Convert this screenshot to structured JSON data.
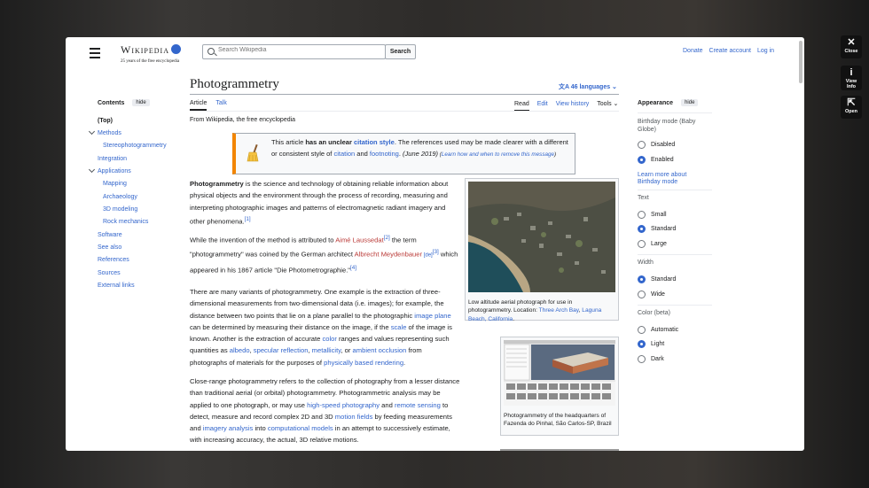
{
  "header": {
    "logo_word": "Wikipedia",
    "logo_tagline": "25 years of the free encyclopedia",
    "search_placeholder": "Search Wikipedia",
    "search_button": "Search",
    "donate": "Donate",
    "create_account": "Create account",
    "login": "Log in"
  },
  "toc": {
    "title": "Contents",
    "hide": "hide",
    "items": [
      "(Top)",
      "Methods",
      "Stereophotogrammetry",
      "Integration",
      "Applications",
      "Mapping",
      "Archaeology",
      "3D modeling",
      "Rock mechanics",
      "Software",
      "See also",
      "References",
      "Sources",
      "External links"
    ]
  },
  "article": {
    "title": "Photogrammetry",
    "languages": "46 languages",
    "tab_article": "Article",
    "tab_talk": "Talk",
    "tab_read": "Read",
    "tab_edit": "Edit",
    "tab_history": "View history",
    "tab_tools": "Tools",
    "from": "From Wikipedia, the free encyclopedia"
  },
  "ambox": {
    "t1": "This article ",
    "t2": "has an unclear ",
    "t3": "citation style",
    "t4": ". The references used may be made clearer with a different or consistent style of ",
    "t5": "citation",
    "t6": " and ",
    "t7": "footnoting",
    "t8": ". ",
    "t9": "(June 2019)",
    "t10": " (",
    "t11": "Learn how and when to remove this message",
    "t12": ")"
  },
  "p1": {
    "bold": "Photogrammetry",
    "text": " is the science and technology of obtaining reliable information about physical objects and the environment through the process of recording, measuring and interpreting photographic images and patterns of electromagnetic radiant imagery and other phenomena.",
    "ref": "[1]"
  },
  "p2": {
    "a": "While the invention of the method is attributed to ",
    "b": "Aimé Laussedat",
    "c": "[2]",
    "d": " the term \"photogrammetry\" was coined by the German architect ",
    "e": "Albrecht Meydenbauer",
    "f": " [de]",
    "g": "[3]",
    "h": " which appeared in his 1867 article \"Die Photometrographie.\"",
    "i": "[4]"
  },
  "p3": {
    "a": "There are many variants of photogrammetry. One example is the extraction of three-dimensional measurements from two-dimensional data (i.e. images); for example, the distance between two points that lie on a plane parallel to the photographic ",
    "b": "image plane",
    "c": " can be determined by measuring their distance on the image, if the ",
    "d": "scale",
    "e": " of the image is known. Another is the extraction of accurate ",
    "f": "color",
    "g": " ranges and values representing such quantities as ",
    "h": "albedo",
    "i": ", ",
    "j": "specular reflection",
    "k": ", ",
    "l": "metallicity",
    "m": ", or ",
    "n": "ambient occlusion",
    "o": " from photographs of materials for the purposes of ",
    "p": "physically based rendering",
    "q": "."
  },
  "p4": {
    "a": "Close-range photogrammetry refers to the collection of photography from a lesser distance than traditional aerial (or orbital) photogrammetry. Photogrammetric analysis may be applied to one photograph, or may use ",
    "b": "high-speed photography",
    "c": " and ",
    "d": "remote sensing",
    "e": " to detect, measure and record complex 2D and 3D ",
    "f": "motion fields",
    "g": " by feeding measurements and ",
    "h": "imagery analysis",
    "i": " into ",
    "j": "computational models",
    "k": " in an attempt to successively estimate, with increasing accuracy, the actual, 3D relative motions."
  },
  "fig1": {
    "a": "Low altitude aerial photograph for use in photogrammetry. Location: ",
    "b": "Three Arch Bay",
    "c": ", ",
    "d": "Laguna Beach, California",
    "e": "."
  },
  "fig2": {
    "cap": "Photogrammetry of the headquarters of Fazenda do Pinhal, São Carlos-SP, Brazil"
  },
  "appearance": {
    "title": "Appearance",
    "hide": "hide",
    "birthday_label": "Birthday mode (Baby Globe)",
    "disabled": "Disabled",
    "enabled": "Enabled",
    "learn_more": "Learn more about Birthday mode",
    "text_label": "Text",
    "small": "Small",
    "standard": "Standard",
    "large": "Large",
    "width_label": "Width",
    "width_standard": "Standard",
    "wide": "Wide",
    "color_label": "Color (beta)",
    "automatic": "Automatic",
    "light": "Light",
    "dark": "Dark"
  },
  "overlay": {
    "close": "Close",
    "view_info": "View Info",
    "open": "Open"
  },
  "colors": {
    "link": "#3366cc",
    "redlink": "#ba3a37",
    "ambox_border": "#f28500"
  }
}
